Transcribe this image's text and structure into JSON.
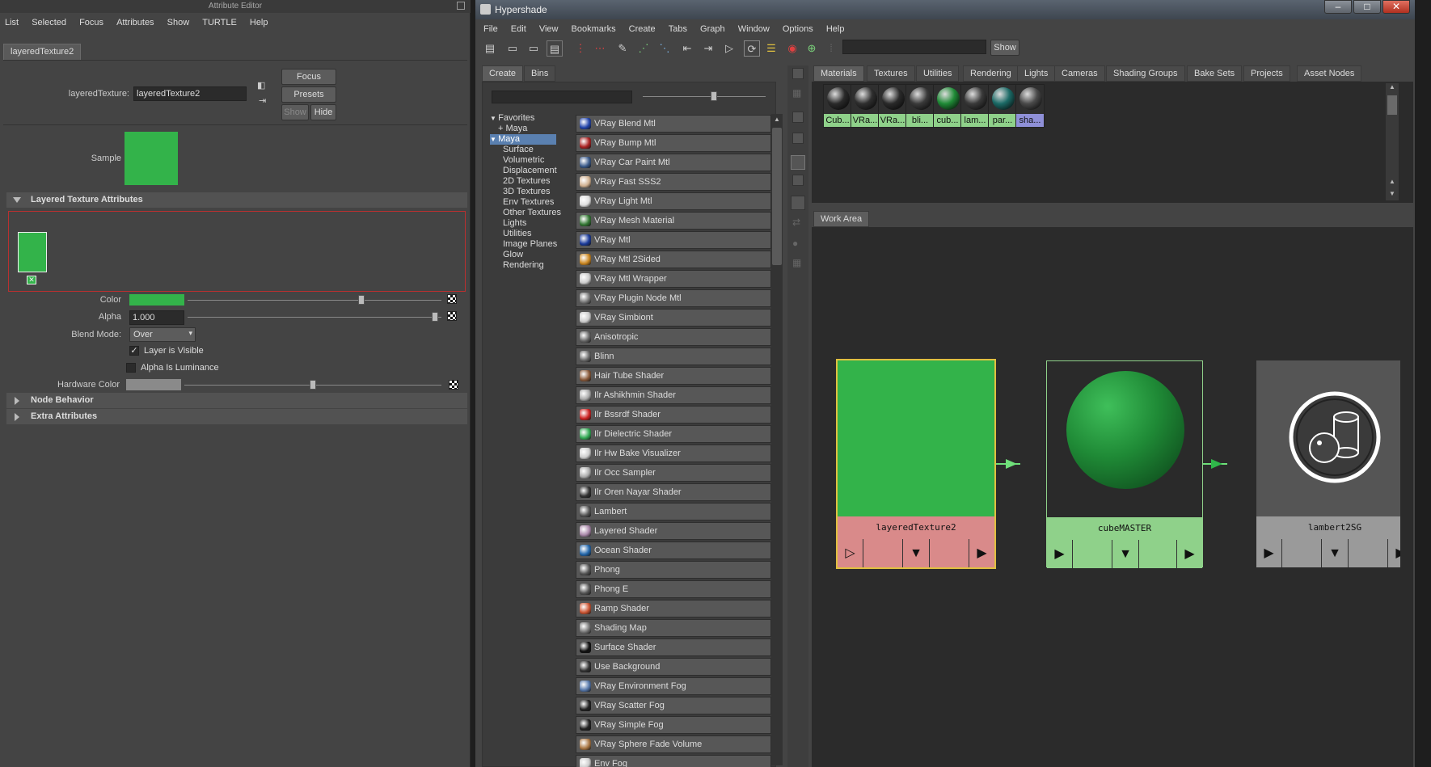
{
  "attribute_editor": {
    "window_title": "Attribute Editor",
    "menu": [
      "List",
      "Selected",
      "Focus",
      "Attributes",
      "Show",
      "TURTLE",
      "Help"
    ],
    "tab": "layeredTexture2",
    "node_type_label": "layeredTexture:",
    "node_name": "layeredTexture2",
    "buttons": {
      "focus": "Focus",
      "presets": "Presets",
      "show": "Show",
      "hide": "Hide"
    },
    "sample_label": "Sample",
    "section_layered": "Layered Texture Attributes",
    "color_label": "Color",
    "alpha_label": "Alpha",
    "alpha_value": "1.000",
    "blend_mode_label": "Blend Mode:",
    "blend_mode_value": "Over",
    "layer_visible": "Layer is Visible",
    "alpha_luminance": "Alpha Is Luminance",
    "hardware_color": "Hardware Color",
    "section_node_behavior": "Node Behavior",
    "section_extra": "Extra Attributes",
    "colors": {
      "green": "#33b34a"
    }
  },
  "hypershade": {
    "window_title": "Hypershade",
    "menu": [
      "File",
      "Edit",
      "View",
      "Bookmarks",
      "Create",
      "Tabs",
      "Graph",
      "Window",
      "Options",
      "Help"
    ],
    "show_button": "Show",
    "left_tabs": [
      "Create",
      "Bins"
    ],
    "tree": {
      "favorites": "Favorites",
      "favorites_maya": "Maya",
      "maya": "Maya",
      "children": [
        "Surface",
        "Volumetric",
        "Displacement",
        "2D Textures",
        "3D Textures",
        "Env Textures",
        "Other Textures",
        "Lights",
        "Utilities",
        "Image Planes",
        "Glow",
        "Rendering"
      ]
    },
    "create_list": [
      {
        "label": "VRay Blend Mtl",
        "icon": "sphere-blue-icon",
        "color": "#2244aa"
      },
      {
        "label": "VRay Bump Mtl",
        "icon": "bump-red-icon",
        "color": "#aa2222"
      },
      {
        "label": "VRay Car Paint Mtl",
        "icon": "sphere-blue-icon",
        "color": "#3a5a8a"
      },
      {
        "label": "VRay Fast SSS2",
        "icon": "sss-icon",
        "color": "#d0b090"
      },
      {
        "label": "VRay Light Mtl",
        "icon": "light-mtl-icon",
        "color": "#dddddd"
      },
      {
        "label": "VRay Mesh Material",
        "icon": "mesh-icon",
        "color": "#337733"
      },
      {
        "label": "VRay Mtl",
        "icon": "sphere-blue-icon",
        "color": "#1a3a9a"
      },
      {
        "label": "VRay Mtl 2Sided",
        "icon": "two-sided-icon",
        "color": "#cc8822"
      },
      {
        "label": "VRay Mtl Wrapper",
        "icon": "wrapper-icon",
        "color": "#cccccc"
      },
      {
        "label": "VRay Plugin Node Mtl",
        "icon": "plugin-icon",
        "color": "#777777"
      },
      {
        "label": "VRay Simbiont",
        "icon": "simbiont-icon",
        "color": "#cccccc"
      },
      {
        "label": "Anisotropic",
        "icon": "sphere-gray-icon",
        "color": "#666666"
      },
      {
        "label": "Blinn",
        "icon": "sphere-gray-icon",
        "color": "#666666"
      },
      {
        "label": "Hair Tube Shader",
        "icon": "hair-tube-icon",
        "color": "#8a5a3a"
      },
      {
        "label": "Ilr Ashikhmin Shader",
        "icon": "sphere-white-icon",
        "color": "#aaaaaa"
      },
      {
        "label": "Ilr Bssrdf Shader",
        "icon": "bssrdf-icon",
        "color": "#cc2222"
      },
      {
        "label": "Ilr Dielectric Shader",
        "icon": "dielectric-icon",
        "color": "#33aa55"
      },
      {
        "label": "Ilr Hw Bake Visualizer",
        "icon": "vis-icon",
        "color": "#cccccc"
      },
      {
        "label": "Ilr Occ Sampler",
        "icon": "occ-icon",
        "color": "#aaaaaa"
      },
      {
        "label": "Ilr Oren Nayar Shader",
        "icon": "sphere-dark-icon",
        "color": "#333333"
      },
      {
        "label": "Lambert",
        "icon": "sphere-gray-icon",
        "color": "#555555"
      },
      {
        "label": "Layered Shader",
        "icon": "layered-shader-icon",
        "color": "#aa88aa"
      },
      {
        "label": "Ocean Shader",
        "icon": "ocean-icon",
        "color": "#2266aa"
      },
      {
        "label": "Phong",
        "icon": "sphere-gray-icon",
        "color": "#555555"
      },
      {
        "label": "Phong E",
        "icon": "sphere-gray-icon",
        "color": "#555555"
      },
      {
        "label": "Ramp Shader",
        "icon": "ramp-icon",
        "color": "#cc5533"
      },
      {
        "label": "Shading Map",
        "icon": "shading-map-icon",
        "color": "#777777"
      },
      {
        "label": "Surface Shader",
        "icon": "sphere-black-icon",
        "color": "#111111"
      },
      {
        "label": "Use Background",
        "icon": "use-bg-icon",
        "color": "#333333"
      },
      {
        "label": "VRay Environment Fog",
        "icon": "fog-icon",
        "color": "#5577aa"
      },
      {
        "label": "VRay Scatter Fog",
        "icon": "scatter-fog-icon",
        "color": "#222222"
      },
      {
        "label": "VRay Simple Fog",
        "icon": "simple-fog-icon",
        "color": "#222222"
      },
      {
        "label": "VRay Sphere Fade Volume",
        "icon": "sphere-fade-icon",
        "color": "#aa7744"
      },
      {
        "label": "Env Fog",
        "icon": "env-fog-icon",
        "color": "#cccccc"
      }
    ],
    "top_tabs": [
      "Materials",
      "Textures",
      "Utilities",
      "Rendering",
      "Lights",
      "Cameras",
      "Shading Groups",
      "Bake Sets",
      "Projects",
      "Asset Nodes"
    ],
    "swatches": [
      {
        "label": "Cub...",
        "ball": "#2a2a2a",
        "bg": "#8fd18a"
      },
      {
        "label": "VRa...",
        "ball": "#2f2f2f",
        "bg": "#8fd18a"
      },
      {
        "label": "VRa...",
        "ball": "#2a2a2a",
        "bg": "#8fd18a"
      },
      {
        "label": "bli...",
        "ball": "#3a3a3a",
        "bg": "#8fd18a"
      },
      {
        "label": "cub...",
        "ball": "#1f8a36",
        "bg": "#8fd18a"
      },
      {
        "label": "lam...",
        "ball": "#3a3a3a",
        "bg": "#8fd18a"
      },
      {
        "label": "par...",
        "ball": "#1b6a66",
        "bg": "#8fd18a"
      },
      {
        "label": "sha...",
        "ball": "#4a4a4a",
        "bg": "#8f90d8"
      }
    ],
    "work_area_tab": "Work Area",
    "nodes": [
      {
        "label": "layeredTexture2",
        "kind": "texture",
        "color": "#33b34a",
        "label_bg": "#d98a8a"
      },
      {
        "label": "cubeMASTER",
        "kind": "material",
        "color": "#1f8a36",
        "label_bg": "#8fd18a"
      },
      {
        "label": "lambert2SG",
        "kind": "shading-group",
        "color": "#555555",
        "label_bg": "#9a9a9a"
      }
    ],
    "colors": {
      "connection": "#6fe07a",
      "selected_outline": "#e0c040"
    }
  }
}
